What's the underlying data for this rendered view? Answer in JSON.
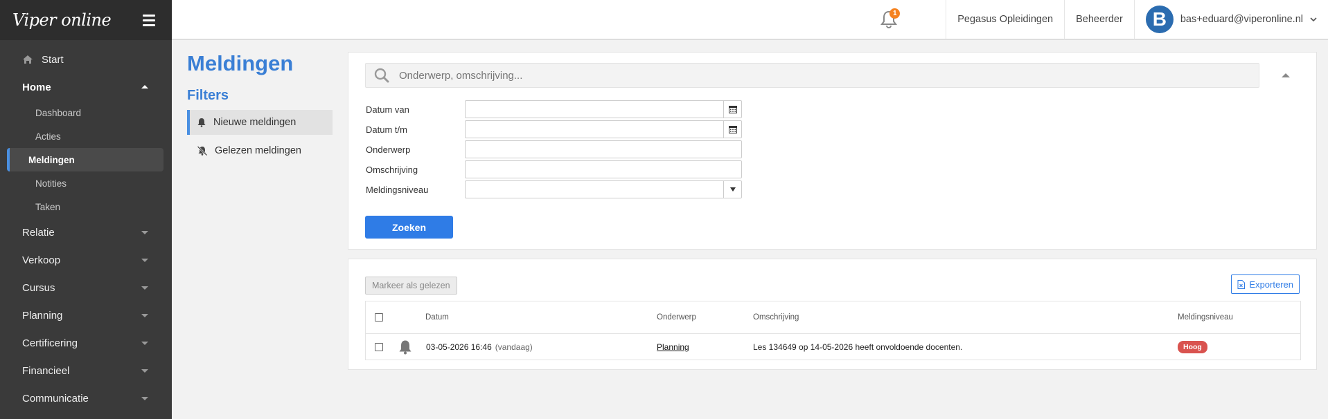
{
  "app": {
    "logo": "Viper online"
  },
  "sidebar": {
    "items": [
      {
        "label": "Start"
      },
      {
        "label": "Home"
      },
      {
        "label": "Relatie"
      },
      {
        "label": "Verkoop"
      },
      {
        "label": "Cursus"
      },
      {
        "label": "Planning"
      },
      {
        "label": "Certificering"
      },
      {
        "label": "Financieel"
      },
      {
        "label": "Communicatie"
      }
    ],
    "home_sub": [
      {
        "label": "Dashboard"
      },
      {
        "label": "Acties"
      },
      {
        "label": "Meldingen"
      },
      {
        "label": "Notities"
      },
      {
        "label": "Taken"
      }
    ]
  },
  "topbar": {
    "notification_count": "1",
    "organisation": "Pegasus Opleidingen",
    "role": "Beheerder",
    "avatar_letter": "B",
    "user_email": "bas+eduard@viperonline.nl"
  },
  "page": {
    "title": "Meldingen",
    "filters_title": "Filters",
    "filters": [
      {
        "label": "Nieuwe meldingen"
      },
      {
        "label": "Gelezen meldingen"
      }
    ]
  },
  "search": {
    "placeholder": "Onderwerp, omschrijving...",
    "fields": {
      "datum_van": {
        "label": "Datum van",
        "value": ""
      },
      "datum_tm": {
        "label": "Datum t/m",
        "value": ""
      },
      "onderwerp": {
        "label": "Onderwerp",
        "value": ""
      },
      "omschrijving": {
        "label": "Omschrijving",
        "value": ""
      },
      "meldingsniveau": {
        "label": "Meldingsniveau",
        "value": ""
      }
    },
    "submit_label": "Zoeken"
  },
  "results": {
    "mark_read_label": "Markeer als gelezen",
    "export_label": "Exporteren",
    "columns": {
      "datum": "Datum",
      "onderwerp": "Onderwerp",
      "omschrijving": "Omschrijving",
      "niveau": "Meldingsniveau"
    },
    "rows": [
      {
        "datum": "03-05-2026 16:46",
        "relative": "(vandaag)",
        "onderwerp": "Planning",
        "omschrijving": "Les 134649 op 14-05-2026 heeft onvoldoende docenten.",
        "niveau": "Hoog"
      }
    ]
  },
  "colors": {
    "accent": "#3a7fd5",
    "primary_button": "#2f7ce6",
    "badge_high": "#d9534f",
    "notification": "#f5821f",
    "sidebar": "#3a3a3a"
  }
}
